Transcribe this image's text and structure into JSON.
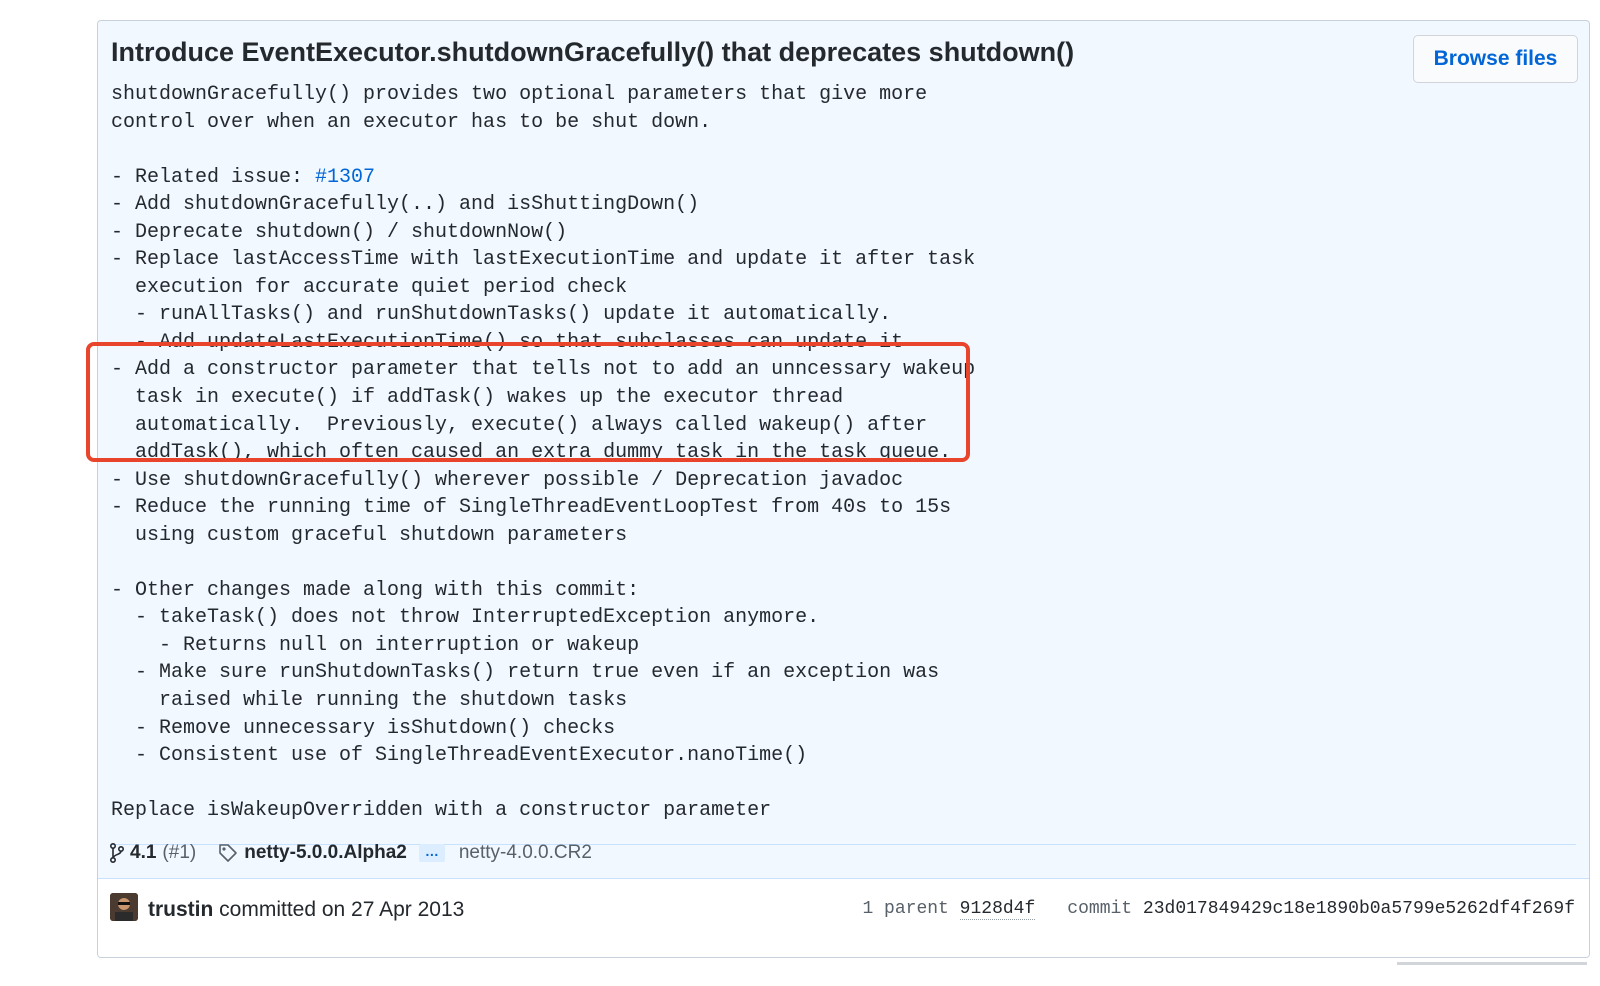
{
  "commit": {
    "title": "Introduce EventExecutor.shutdownGracefully() that deprecates shutdown()",
    "browse_files_label": "Browse files",
    "message_lines": [
      {
        "text": "shutdownGracefully() provides two optional parameters that give more"
      },
      {
        "text": "control over when an executor has to be shut down."
      },
      {
        "text": ""
      },
      {
        "text": "- Related issue: ",
        "link": "#1307"
      },
      {
        "text": "- Add shutdownGracefully(..) and isShuttingDown()"
      },
      {
        "text": "- Deprecate shutdown() / shutdownNow()"
      },
      {
        "text": "- Replace lastAccessTime with lastExecutionTime and update it after task"
      },
      {
        "text": "  execution for accurate quiet period check"
      },
      {
        "text": "  - runAllTasks() and runShutdownTasks() update it automatically."
      },
      {
        "text": "  - Add updateLastExecutionTime() so that subclasses can update it"
      },
      {
        "text": "- Add a constructor parameter that tells not to add an unncessary wakeup"
      },
      {
        "text": "  task in execute() if addTask() wakes up the executor thread"
      },
      {
        "text": "  automatically.  Previously, execute() always called wakeup() after"
      },
      {
        "text": "  addTask(), which often caused an extra dummy task in the task queue."
      },
      {
        "text": "- Use shutdownGracefully() wherever possible / Deprecation javadoc"
      },
      {
        "text": "- Reduce the running time of SingleThreadEventLoopTest from 40s to 15s"
      },
      {
        "text": "  using custom graceful shutdown parameters"
      },
      {
        "text": ""
      },
      {
        "text": "- Other changes made along with this commit:"
      },
      {
        "text": "  - takeTask() does not throw InterruptedException anymore."
      },
      {
        "text": "    - Returns null on interruption or wakeup"
      },
      {
        "text": "  - Make sure runShutdownTasks() return true even if an exception was"
      },
      {
        "text": "    raised while running the shutdown tasks"
      },
      {
        "text": "  - Remove unnecessary isShutdown() checks"
      },
      {
        "text": "  - Consistent use of SingleThreadEventExecutor.nanoTime()"
      },
      {
        "text": ""
      },
      {
        "text": "Replace isWakeupOverridden with a constructor parameter"
      }
    ],
    "branch": {
      "name": "4.1",
      "count": "(#1)"
    },
    "tags": {
      "first": "netty-5.0.0.Alpha2",
      "ellipsis": "…",
      "last": "netty-4.0.0.CR2"
    },
    "author": {
      "name": "trustin",
      "action": " committed on 27 Apr 2013"
    },
    "parent": {
      "label": "1 parent",
      "sha": "9128d4f"
    },
    "commit_info": {
      "label": "commit",
      "sha": "23d017849429c18e1890b0a5799e5262df4f269f"
    }
  },
  "colors": {
    "highlight": "#e8452c",
    "link": "#0366d6",
    "card_bg": "#f1f8ff"
  },
  "icons": {
    "branch": "git-branch-icon",
    "tag": "tag-icon",
    "avatar": "user-avatar"
  }
}
